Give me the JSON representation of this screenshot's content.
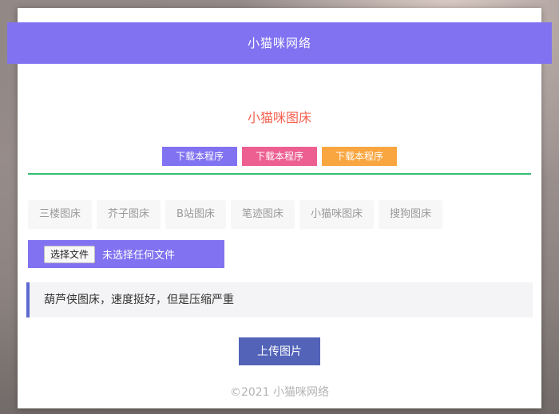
{
  "colors": {
    "banner_purple": "#8172f1",
    "download_purple": "#8172f1",
    "download_pink": "#ec5f90",
    "download_orange": "#f9a640",
    "divider_green": "#35bd74",
    "title_red": "#f55f4e",
    "notice_border_indigo": "#5a6ad0",
    "upload_blue": "#5263b8"
  },
  "banner": {
    "title": "小猫咪网络"
  },
  "main": {
    "page_title": "小猫咪图床",
    "download_buttons": [
      {
        "label": "下载本程序",
        "color": "#8172f1"
      },
      {
        "label": "下载本程序",
        "color": "#ec5f90"
      },
      {
        "label": "下载本程序",
        "color": "#f9a640"
      }
    ],
    "tabs": [
      "三楼图床",
      "芥子图床",
      "B站图床",
      "笔迹图床",
      "小猫咪图床",
      "搜狗图床"
    ],
    "file_input": {
      "button_label": "选择文件",
      "status_text": "未选择任何文件"
    },
    "notice": "葫芦侠图床，速度挺好，但是压缩严重",
    "upload_button": "上传图片"
  },
  "footer": {
    "copyright": "©2021 小猫咪网络"
  }
}
